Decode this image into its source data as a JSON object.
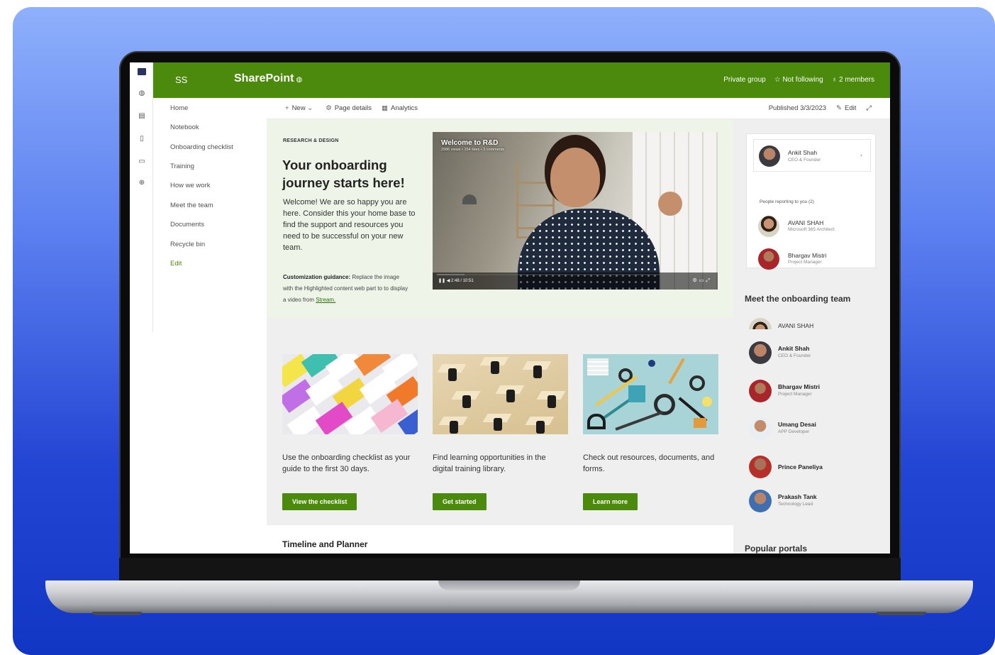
{
  "app": {
    "site_initials": "SS",
    "brand": "SharePoint",
    "header_right": {
      "privacy": "Private group",
      "follow": "☆ Not following",
      "members": "♁ 2 members"
    }
  },
  "nav": {
    "items": [
      "Home",
      "Notebook",
      "Onboarding checklist",
      "Training",
      "How we work",
      "Meet the team",
      "Documents",
      "Recycle bin"
    ],
    "edit": "Edit"
  },
  "command_bar": {
    "new": "New",
    "page_details": "Page details",
    "analytics": "Analytics",
    "published": "Published 3/3/2023",
    "edit": "Edit"
  },
  "hero": {
    "eyebrow": "RESEARCH & DESIGN",
    "title": "Your onboarding journey starts here!",
    "body": "Welcome! We are so happy you are here. Consider this your home base to find the support and resources you need to be successful on your new team.",
    "guidance_label": "Customization guidance:",
    "guidance_text": "Replace the image with the Highlighted content web part to to display a video from",
    "guidance_link": "Stream."
  },
  "video": {
    "title": "Welcome to R&D",
    "meta": "2986 views • 154 likes • 3 comments",
    "time": "2:48 / 10:51",
    "progress": 0.1
  },
  "cards": [
    {
      "text": "Use the onboarding checklist as your guide to the first 30 days.",
      "button": "View the checklist"
    },
    {
      "text": "Find learning opportunities in the digital training library.",
      "button": "Get started"
    },
    {
      "text": "Check out resources, documents, and forms.",
      "button": "Learn more"
    }
  ],
  "timeline": {
    "heading": "Timeline and Planner"
  },
  "org": {
    "manager": {
      "name": "Ankit Shah",
      "role": "CEO & Founder"
    },
    "reporting_label": "People reporting to you (2)",
    "reports": [
      {
        "name": "AVANI SHAH",
        "role": "Microsoft 365 Architect"
      },
      {
        "name": "Bhargav Mistri",
        "role": "Project Manager"
      }
    ]
  },
  "team": {
    "heading": "Meet the onboarding team",
    "members": [
      {
        "name": "AVANI SHAH",
        "role": ""
      },
      {
        "name": "Ankit Shah",
        "role": "CEO & Founder"
      },
      {
        "name": "Bhargav Mistri",
        "role": "Project Manager"
      },
      {
        "name": "Umang Desai",
        "role": "APP Developer"
      },
      {
        "name": "Prince Paneliya",
        "role": ""
      },
      {
        "name": "Prakash Tank",
        "role": "Technology Lead"
      }
    ]
  },
  "popular": {
    "heading": "Popular portals"
  },
  "colors": {
    "brand_green": "#4b8a0c",
    "background_blue": "#2446d4"
  }
}
